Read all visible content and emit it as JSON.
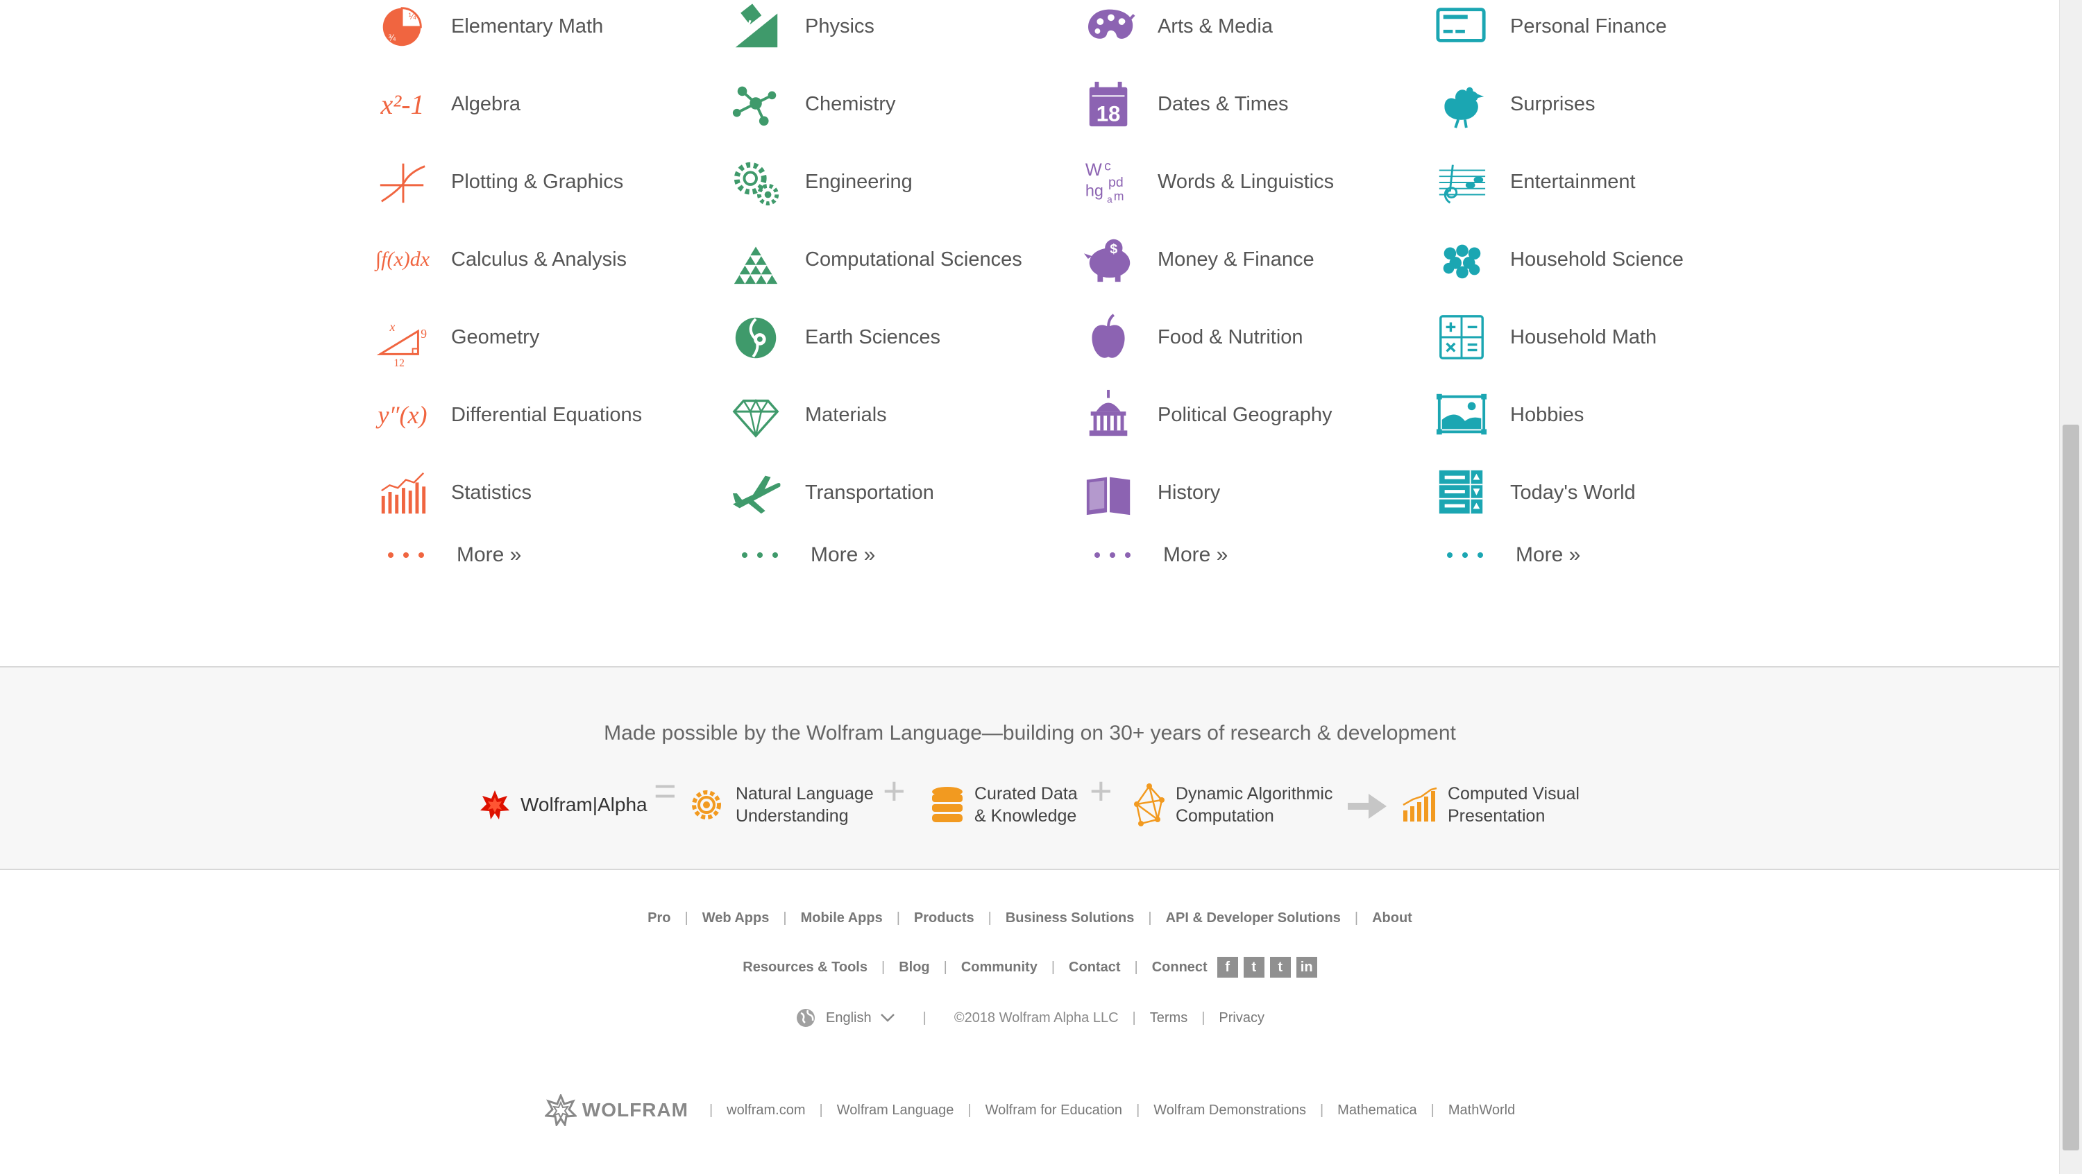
{
  "colors": {
    "math": "#f06540",
    "science": "#3f9a6b",
    "society": "#8c63b2",
    "life": "#1ba6b2"
  },
  "columns": [
    {
      "id": "math",
      "items": [
        {
          "label": "Elementary Math",
          "icon": "pie-fraction-icon"
        },
        {
          "label": "Algebra",
          "icon": "x-squared-icon",
          "glyph": "x²-1"
        },
        {
          "label": "Plotting & Graphics",
          "icon": "plot-curve-icon"
        },
        {
          "label": "Calculus & Analysis",
          "icon": "integral-icon",
          "glyph": "∫f(x)dx"
        },
        {
          "label": "Geometry",
          "icon": "triangle-geometry-icon"
        },
        {
          "label": "Differential Equations",
          "icon": "derivative-icon",
          "glyph": "y″(x)"
        },
        {
          "label": "Statistics",
          "icon": "bar-chart-icon"
        }
      ],
      "more": "More »"
    },
    {
      "id": "science",
      "items": [
        {
          "label": "Physics",
          "icon": "ramp-icon"
        },
        {
          "label": "Chemistry",
          "icon": "molecule-icon"
        },
        {
          "label": "Engineering",
          "icon": "gears-icon"
        },
        {
          "label": "Computational Sciences",
          "icon": "triangle-automaton-icon"
        },
        {
          "label": "Earth Sciences",
          "icon": "globe-icon"
        },
        {
          "label": "Materials",
          "icon": "diamond-icon"
        },
        {
          "label": "Transportation",
          "icon": "airplane-icon"
        }
      ],
      "more": "More »"
    },
    {
      "id": "society",
      "items": [
        {
          "label": "Arts & Media",
          "icon": "palette-icon"
        },
        {
          "label": "Dates & Times",
          "icon": "calendar-icon",
          "glyph": "18"
        },
        {
          "label": "Words & Linguistics",
          "icon": "letters-icon"
        },
        {
          "label": "Money & Finance",
          "icon": "piggy-bank-icon"
        },
        {
          "label": "Food & Nutrition",
          "icon": "apple-icon"
        },
        {
          "label": "Political Geography",
          "icon": "capitol-icon"
        },
        {
          "label": "History",
          "icon": "book-icon"
        }
      ],
      "more": "More »"
    },
    {
      "id": "life",
      "items": [
        {
          "label": "Personal Finance",
          "icon": "credit-card-icon"
        },
        {
          "label": "Surprises",
          "icon": "chicken-icon"
        },
        {
          "label": "Entertainment",
          "icon": "music-staff-icon"
        },
        {
          "label": "Household Science",
          "icon": "grapes-icon"
        },
        {
          "label": "Household Math",
          "icon": "calculator-icon"
        },
        {
          "label": "Hobbies",
          "icon": "picture-icon"
        },
        {
          "label": "Today's World",
          "icon": "stats-board-icon"
        }
      ],
      "more": "More »"
    }
  ],
  "band": {
    "tagline": "Made possible by the Wolfram Language—building on 30+ years of research & development",
    "logo_text": "Wolfram|Alpha",
    "eq_sign": "=",
    "plus": "+",
    "arrow": "→",
    "parts": [
      {
        "line1": "Natural Language",
        "line2": "Understanding"
      },
      {
        "line1": "Curated Data",
        "line2": "& Knowledge"
      },
      {
        "line1": "Dynamic Algorithmic",
        "line2": "Computation"
      },
      {
        "line1": "Computed Visual",
        "line2": "Presentation"
      }
    ]
  },
  "footer": {
    "row1": [
      "Pro",
      "Web Apps",
      "Mobile Apps",
      "Products",
      "Business Solutions",
      "API & Developer Solutions",
      "About"
    ],
    "row2": [
      "Resources & Tools",
      "Blog",
      "Community",
      "Contact",
      "Connect"
    ],
    "social": [
      "f",
      "t",
      "t",
      "in"
    ],
    "language": "English",
    "copyright": "©2018 Wolfram Alpha LLC",
    "terms": "Terms",
    "privacy": "Privacy",
    "wolfram_logo": "WOLFRAM",
    "row4": [
      "wolfram.com",
      "Wolfram Language",
      "Wolfram for Education",
      "Wolfram Demonstrations",
      "Mathematica",
      "MathWorld"
    ]
  }
}
